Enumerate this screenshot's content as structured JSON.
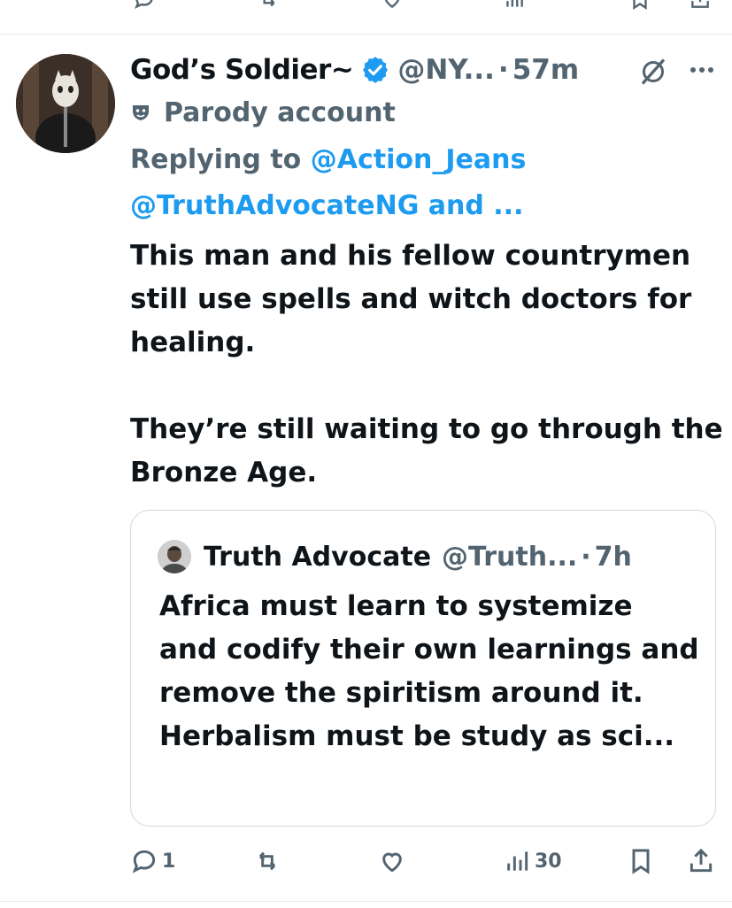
{
  "tweet": {
    "author_name": "God’s Soldier~",
    "handle": "@NY...",
    "dot": "·",
    "time": "57m",
    "parody_label": "Parody account",
    "replying_prefix": "Replying to",
    "replying_handle_1": "@Action_Jeans",
    "replying_handle_2": "@TruthAdvocateNG and ...",
    "body_para_1": "This man and his fellow countrymen still use spells and witch doctors for healing.",
    "body_para_2": "They’re still waiting to go through the Bronze Age."
  },
  "quote": {
    "name": "Truth Advocate",
    "handle": "@Truth...",
    "dot": "·",
    "time": "7h",
    "text_line_1": "Africa must learn to systemize and codify their own learnings and remove the spiritism around it.",
    "text_line_2": "Herbalism must be study as sci..."
  },
  "actions": {
    "reply_count": "1",
    "views_count": "30"
  },
  "icons": {
    "top_strip": [
      "reply-icon",
      "retweet-icon",
      "like-icon",
      "views-icon",
      "bookmark-icon",
      "share-icon"
    ],
    "header": [
      "verified-badge-icon",
      "grok-icon",
      "more-icon",
      "parody-mask-icon"
    ],
    "actions": [
      "reply-icon",
      "retweet-icon",
      "like-icon",
      "views-icon",
      "bookmark-icon",
      "share-icon"
    ]
  },
  "colors": {
    "link_blue": "#1d9bf0",
    "muted_gray": "#536471",
    "text_dark": "#0f1419",
    "border": "#cfd9de"
  }
}
